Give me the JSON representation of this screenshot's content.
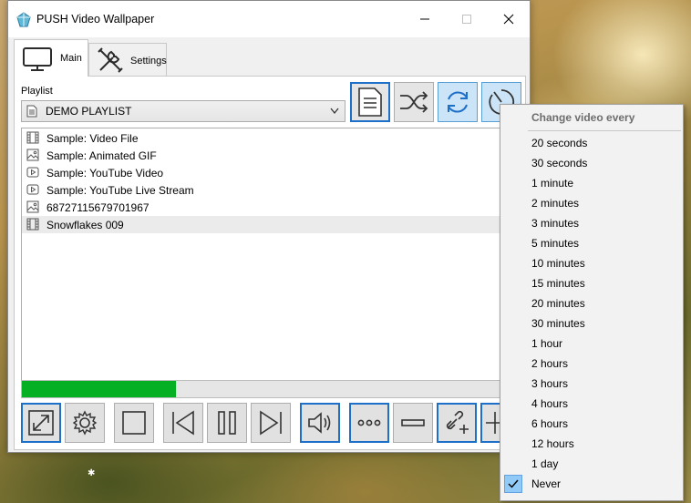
{
  "window": {
    "title": "PUSH Video Wallpaper"
  },
  "tabs": [
    {
      "label": "Main",
      "icon": "monitor-icon",
      "active": true
    },
    {
      "label": "Settings",
      "icon": "tools-icon",
      "active": false
    }
  ],
  "playlist": {
    "label": "Playlist",
    "selected": "DEMO PLAYLIST"
  },
  "items": [
    {
      "label": "Sample: Video File",
      "icon": "film-icon"
    },
    {
      "label": "Sample: Animated GIF",
      "icon": "image-icon"
    },
    {
      "label": "Sample: YouTube Video",
      "icon": "youtube-icon"
    },
    {
      "label": "Sample: YouTube Live Stream",
      "icon": "youtube-icon"
    },
    {
      "label": "68727115679701967",
      "icon": "image-icon"
    },
    {
      "label": "Snowflakes 009",
      "icon": "film-icon",
      "selected": true
    }
  ],
  "progress": {
    "fraction": 0.32,
    "color": "#06b025"
  },
  "menu": {
    "header": "Change video every",
    "options": [
      "20 seconds",
      "30 seconds",
      "1 minute",
      "2 minutes",
      "3 minutes",
      "5 minutes",
      "10 minutes",
      "15 minutes",
      "20 minutes",
      "30 minutes",
      "1 hour",
      "2 hours",
      "3 hours",
      "4 hours",
      "6 hours",
      "12 hours",
      "1 day",
      "Never"
    ],
    "checked": "Never"
  },
  "colors": {
    "accent": "#1e6fc8",
    "hover": "#cce4f7",
    "check_bg": "#91c9f7"
  }
}
